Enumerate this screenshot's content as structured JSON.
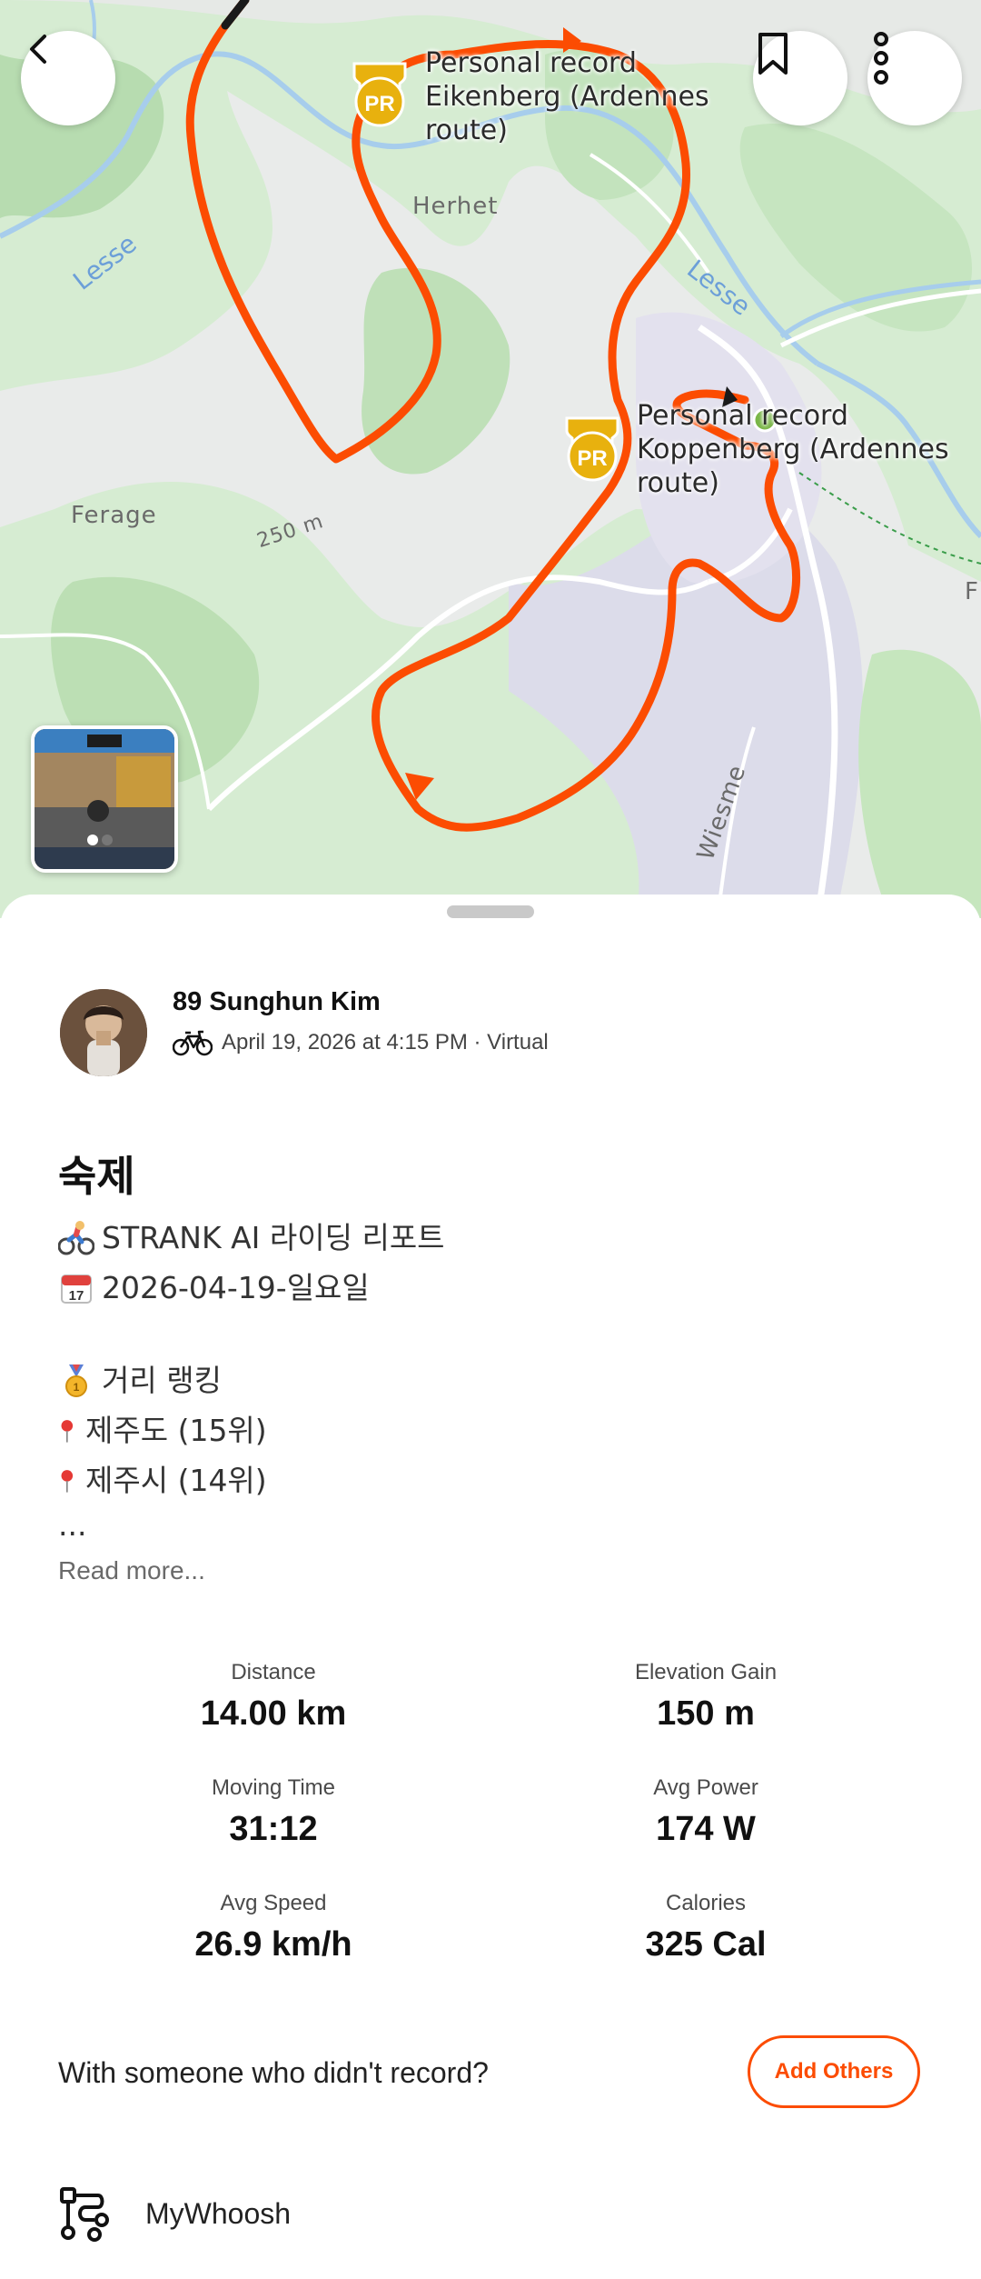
{
  "map": {
    "place_labels": [
      "Herhet",
      "Ferage",
      "Wiesme",
      "F"
    ],
    "river_labels": [
      "Lesse",
      "Lesse"
    ],
    "elevation_label": "250 m",
    "personal_records": [
      {
        "title": "Personal record",
        "segment_line1": "Eikenberg (Ardennes",
        "segment_line2": "route)",
        "badge": "PR"
      },
      {
        "title": "Personal record",
        "segment_line1": "Koppenberg (Ardennes",
        "segment_line2": "route)",
        "badge": "PR"
      }
    ],
    "route_color": "#fc4c02"
  },
  "toolbar": {
    "back_icon": "chevron-left-icon",
    "bookmark_icon": "bookmark-icon",
    "more_icon": "more-vertical-icon"
  },
  "activity": {
    "athlete_name": "89 Sunghun Kim",
    "date_meta": "April 19, 2026 at 4:15 PM · Virtual",
    "sport_icon": "bike-icon",
    "title": "숙제",
    "description": {
      "line1": "STRANK AI 라이딩 리포트",
      "line2": "2026-04-19-일요일",
      "line3": "거리 랭킹",
      "line4": "제주도 (15위)",
      "line5": "제주시 (14위)",
      "line6": "..."
    },
    "read_more": "Read more..."
  },
  "stats": {
    "distance": {
      "label": "Distance",
      "value": "14.00 km"
    },
    "elevation": {
      "label": "Elevation Gain",
      "value": "150 m"
    },
    "moving_time": {
      "label": "Moving Time",
      "value": "31:12"
    },
    "avg_power": {
      "label": "Avg Power",
      "value": "174 W"
    },
    "avg_speed": {
      "label": "Avg Speed",
      "value": "26.9 km/h"
    },
    "calories": {
      "label": "Calories",
      "value": "325 Cal"
    }
  },
  "group": {
    "question": "With someone who didn't record?",
    "button_label": "Add Others"
  },
  "device": {
    "name": "MyWhoosh",
    "icon": "device-route-icon"
  },
  "colors": {
    "accent": "#fc4c02",
    "pr_badge": "#e8b10e"
  }
}
